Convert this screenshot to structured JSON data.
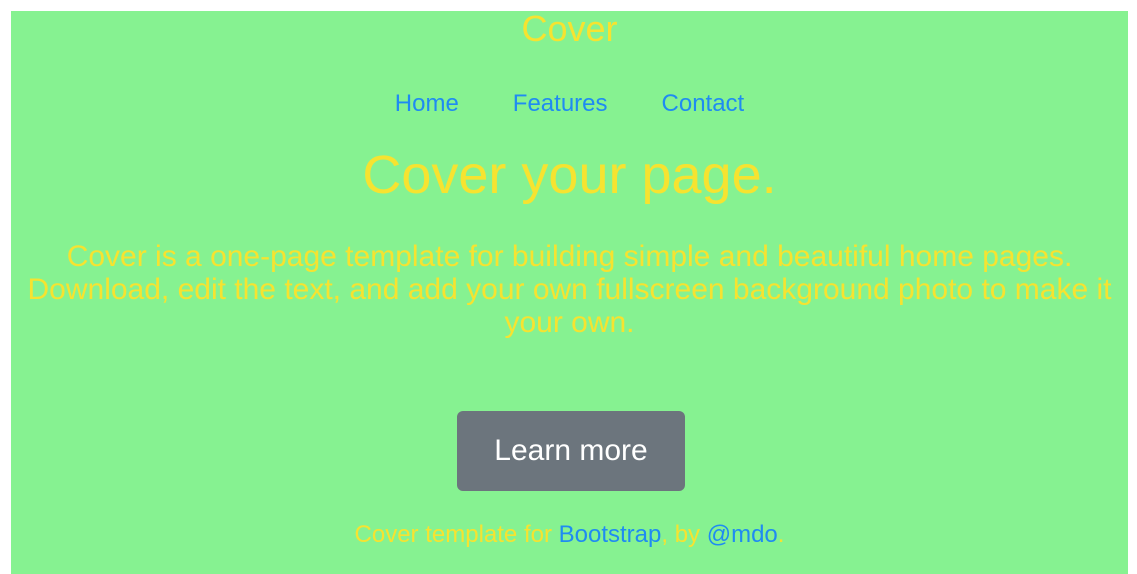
{
  "brand": {
    "title": "Cover"
  },
  "nav": {
    "items": [
      {
        "label": "Home"
      },
      {
        "label": "Features"
      },
      {
        "label": "Contact"
      }
    ]
  },
  "hero": {
    "title": "Cover your page.",
    "description": "Cover is a one-page template for building simple and beautiful home pages. Download, edit the text, and add your own fullscreen background photo to make it your own.",
    "button_label": "Learn more"
  },
  "footer": {
    "prefix": "Cover template for ",
    "bootstrap_link": "Bootstrap",
    "middle": ", by ",
    "author_link": "@mdo",
    "suffix": "."
  },
  "colors": {
    "background": "#86f291",
    "text": "#f6e330",
    "link": "#1f8bf2",
    "button": "#6c757d",
    "button_text": "#ffffff"
  }
}
